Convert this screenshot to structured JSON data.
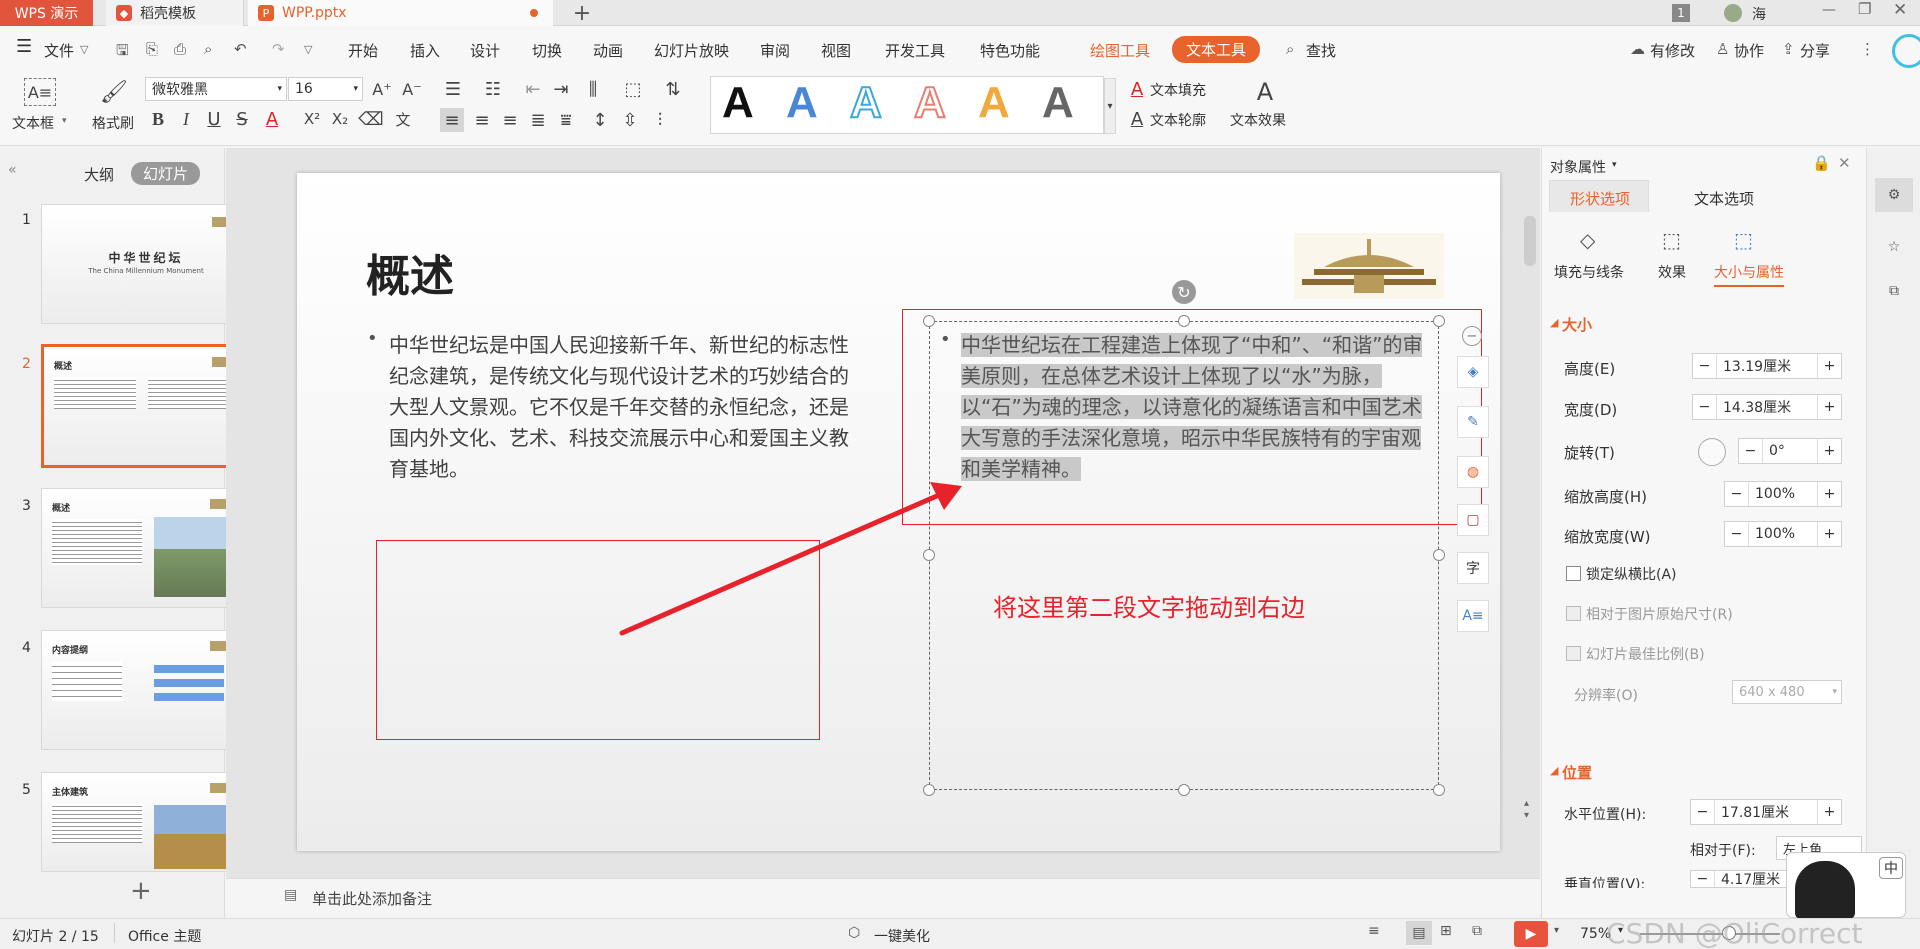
{
  "titlebar": {
    "app_tab": "WPS 演示",
    "tabs": [
      {
        "label": "稻壳模板"
      },
      {
        "label": "WPP.pptx"
      }
    ],
    "new_tab": "+",
    "badge": "1",
    "user": "海"
  },
  "menu": {
    "file": "文件",
    "items": [
      "开始",
      "插入",
      "设计",
      "切换",
      "动画",
      "幻灯片放映",
      "审阅",
      "视图",
      "开发工具",
      "特色功能"
    ],
    "draw_tools": "绘图工具",
    "text_tools": "文本工具",
    "search": "查找",
    "has_changes": "有修改",
    "collab": "协作",
    "share": "分享"
  },
  "ribbon": {
    "textbox": "文本框",
    "format_painter": "格式刷",
    "font_name": "微软雅黑",
    "font_size": "16",
    "text_fill": "文本填充",
    "text_outline": "文本轮廓",
    "text_effect": "文本效果",
    "style_letter": "A"
  },
  "left_panel": {
    "tab_outline": "大纲",
    "tab_slides": "幻灯片",
    "thumbs": [
      {
        "num": "1",
        "title": "中华世纪坛",
        "subtitle": "The China Millennium Monument"
      },
      {
        "num": "2",
        "title": "概述"
      },
      {
        "num": "3",
        "title": "概述"
      },
      {
        "num": "4",
        "title": "内容提纲"
      },
      {
        "num": "5",
        "title": "主体建筑"
      }
    ],
    "add": "+"
  },
  "slide": {
    "title": "概述",
    "left_bullet": "中华世纪坛是中国人民迎接新千年、新世纪的标志性纪念建筑，是传统文化与现代设计艺术的巧妙结合的大型人文景观。它不仅是千年交替的永恒纪念，还是国内外文化、艺术、科技交流展示中心和爱国主义教育基地。",
    "right_bullet": "中华世纪坛在工程建造上体现了“中和”、“和谐”的审美原则，在总体艺术设计上体现了以“水”为脉，以“石”为魂的理念，以诗意化的凝练语言和中国艺术大写意的手法深化意境，昭示中华民族特有的宇宙观和美学精神。",
    "annotation": "将这里第二段文字拖动到右边",
    "annotation_color": "#e8222a"
  },
  "notes": {
    "placeholder": "单击此处添加备注"
  },
  "right_panel": {
    "title": "对象属性",
    "tab_shape": "形状选项",
    "tab_text": "文本选项",
    "sub_fill": "填充与线条",
    "sub_effect": "效果",
    "sub_size": "大小与属性",
    "section_size": "大小",
    "height_label": "高度(E)",
    "height_value": "13.19厘米",
    "width_label": "宽度(D)",
    "width_value": "14.38厘米",
    "rotate_label": "旋转(T)",
    "rotate_value": "0°",
    "scale_h_label": "缩放高度(H)",
    "scale_h_value": "100%",
    "scale_w_label": "缩放宽度(W)",
    "scale_w_value": "100%",
    "lock_ratio": "锁定纵横比(A)",
    "relative_orig": "相对于图片原始尺寸(R)",
    "best_ratio": "幻灯片最佳比例(B)",
    "resolution_label": "分辨率(O)",
    "resolution_value": "640 x 480",
    "section_pos": "位置",
    "hpos_label": "水平位置(H):",
    "hpos_value": "17.81厘米",
    "relative_to": "相对于(F):",
    "relative_value": "左上角",
    "vpos_label": "垂直位置(V):",
    "vpos_value": "4.17厘米",
    "ime": "中"
  },
  "status": {
    "slide_num": "幻灯片 2 / 15",
    "theme": "Office 主题",
    "beautify": "一键美化",
    "zoom": "75%",
    "watermark": "CSDN @OliCorrect"
  },
  "colors": {
    "accent": "#e8622b",
    "wps_red": "#e2553d",
    "highlight": "#c9c9c9"
  }
}
